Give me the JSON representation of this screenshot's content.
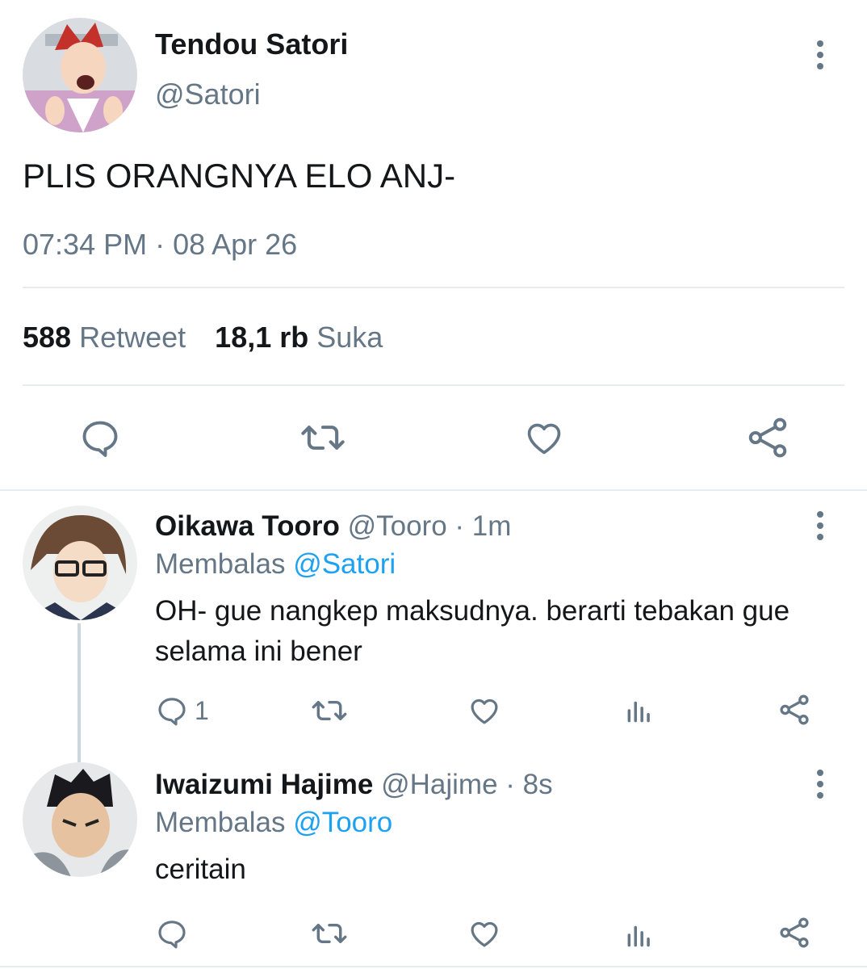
{
  "tweet": {
    "display_name": "Tendou Satori",
    "handle": "@Satori",
    "text": "PLIS ORANGNYA ELO ANJ-",
    "timestamp": "07:34 PM · 08 Apr 26",
    "stats": {
      "retweet_count": "588",
      "retweet_label": "Retweet",
      "like_count": "18,1 rb",
      "like_label": "Suka"
    },
    "actions": [
      "reply-icon",
      "retweet-icon",
      "like-icon",
      "share-icon"
    ]
  },
  "replies": [
    {
      "display_name": "Oikawa Tooro",
      "handle": "@Tooro",
      "time": "· 1m",
      "reply_label": "Membalas",
      "reply_to": "@Satori",
      "text": "OH- gue nangkep maksudnya. berarti tebakan gue selama ini bener",
      "reply_count": "1",
      "actions": [
        "reply-icon",
        "retweet-icon",
        "like-icon",
        "analytics-icon",
        "share-icon"
      ]
    },
    {
      "display_name": "Iwaizumi Hajime",
      "handle": "@Hajime",
      "time": "· 8s",
      "reply_label": "Membalas",
      "reply_to": "@Tooro",
      "text": "ceritain",
      "reply_count": "",
      "actions": [
        "reply-icon",
        "retweet-icon",
        "like-icon",
        "analytics-icon",
        "share-icon"
      ]
    }
  ],
  "colors": {
    "text": "#14171a",
    "secondary": "#657786",
    "link": "#1da1f2",
    "divider": "#e6ecf0"
  }
}
